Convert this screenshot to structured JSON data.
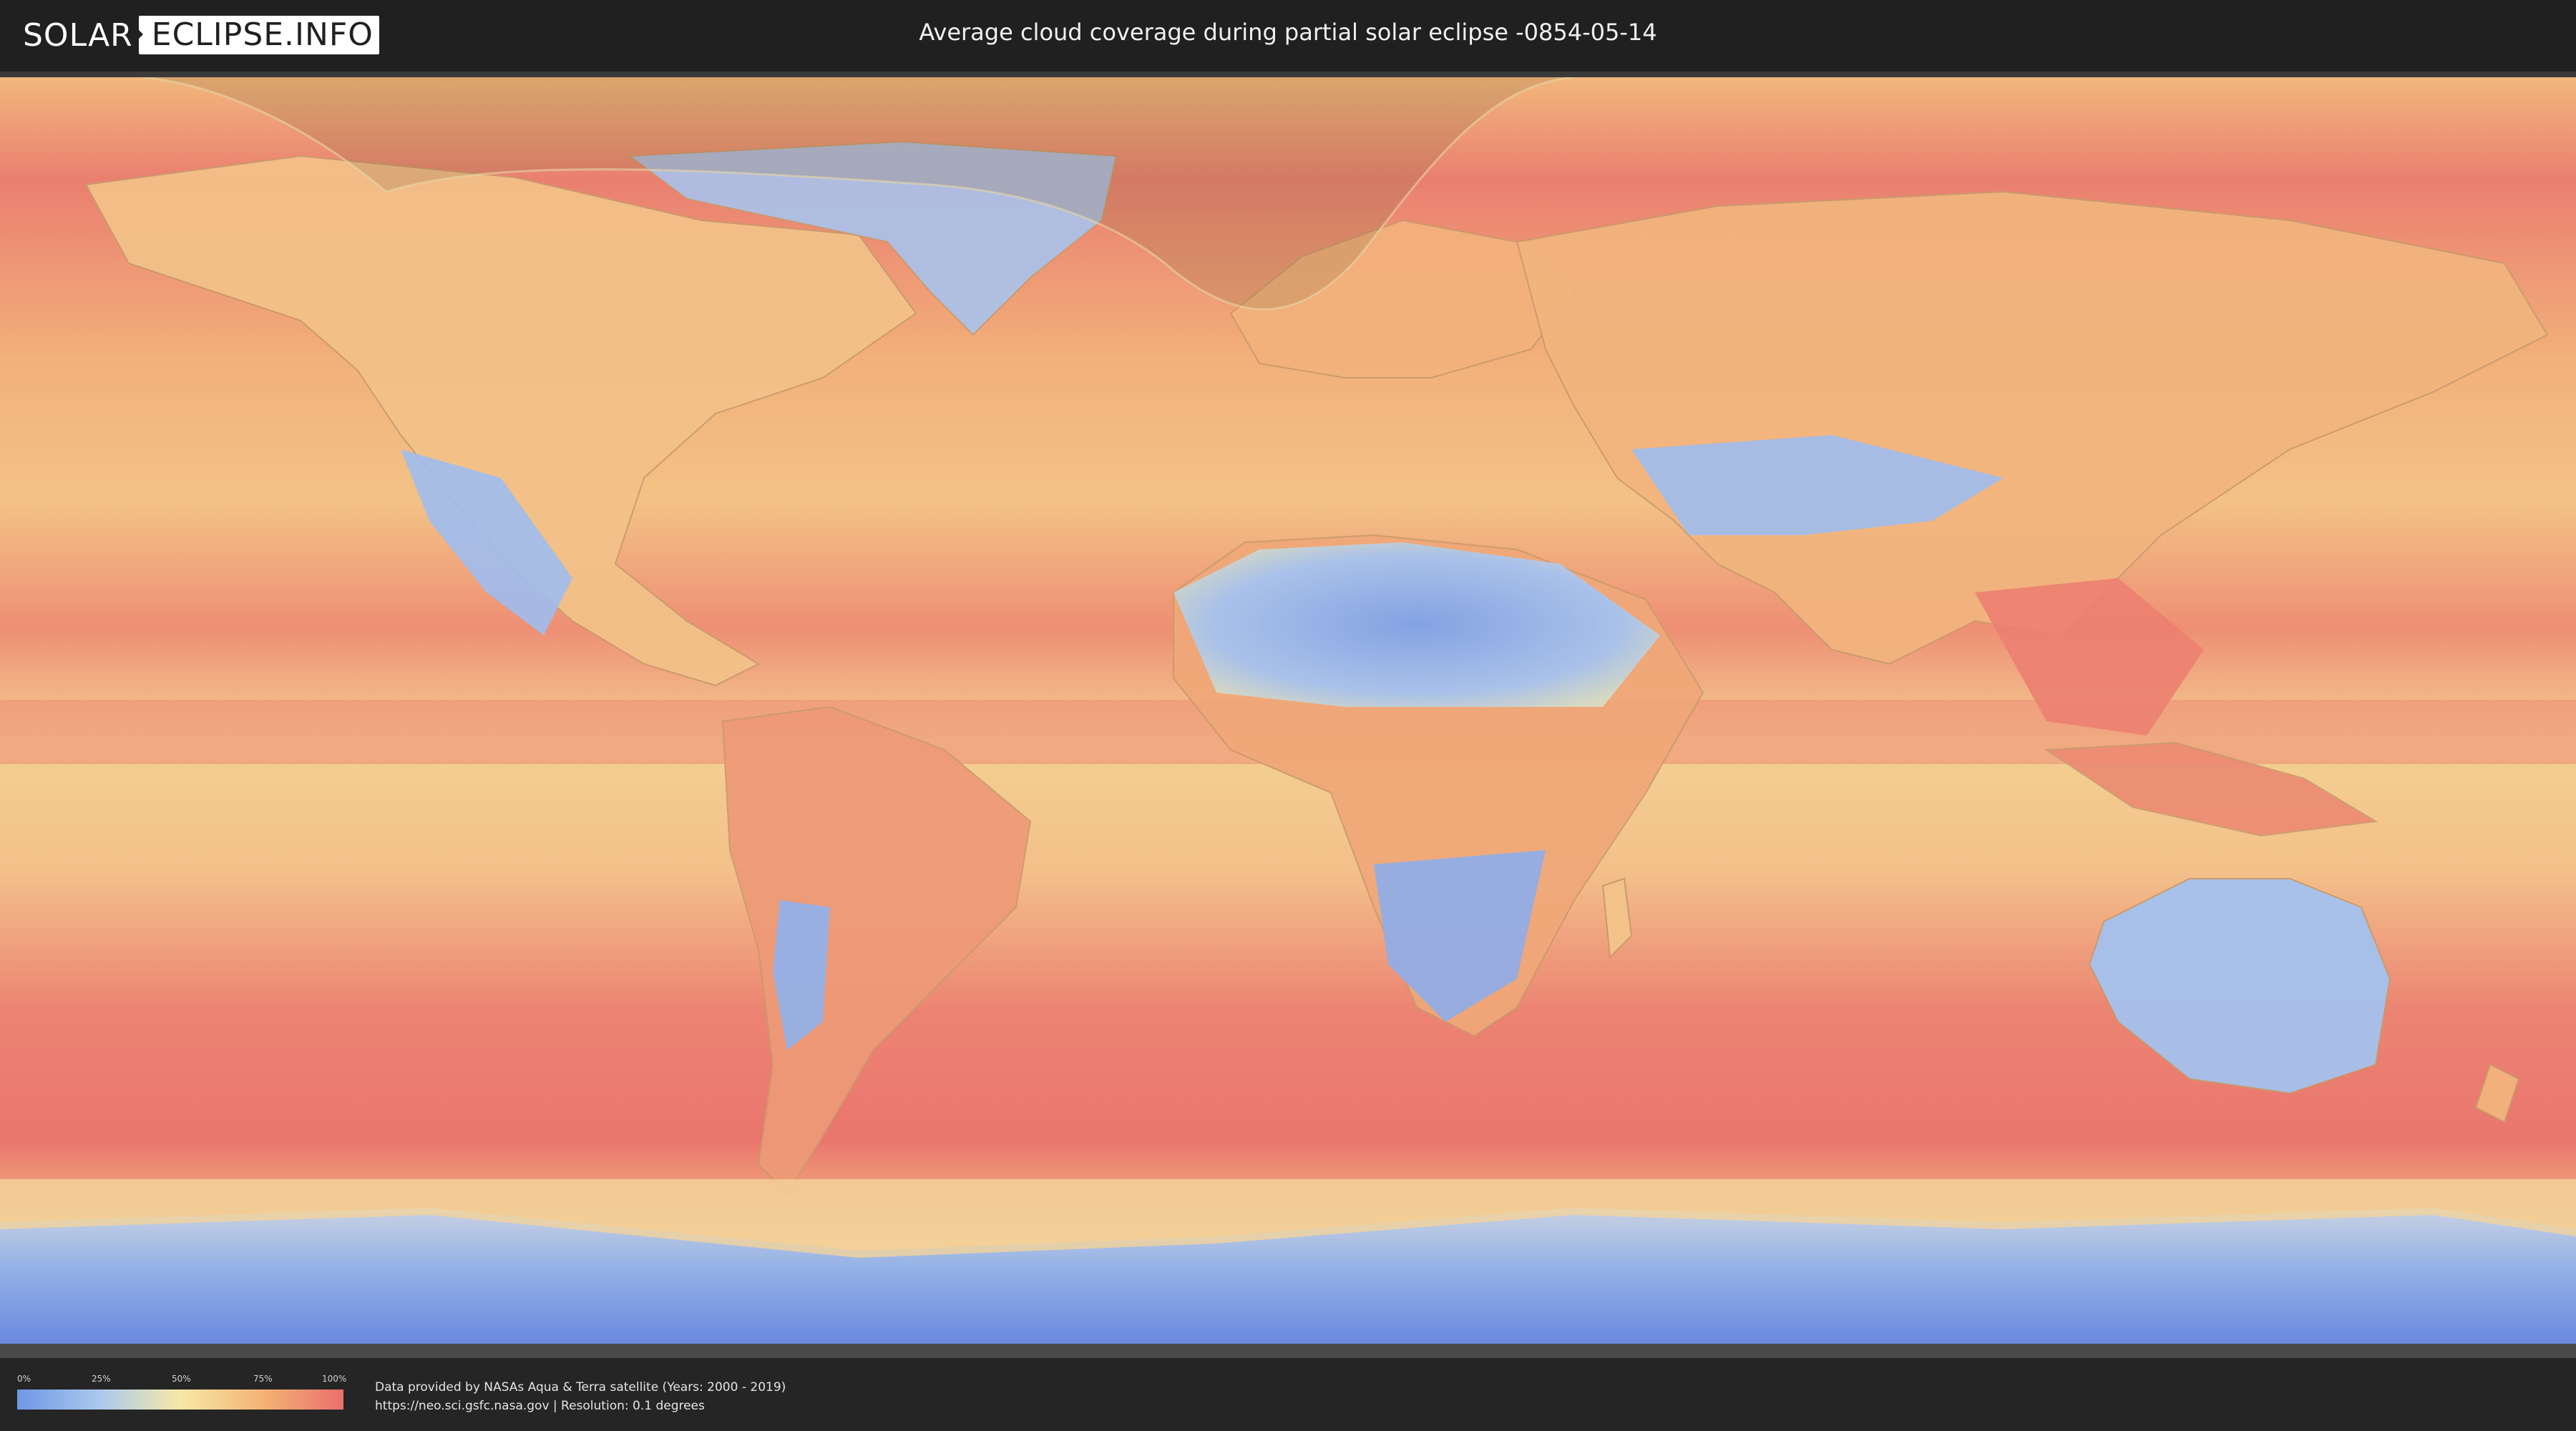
{
  "header": {
    "logo_part1": "SOLAR",
    "logo_part2": "ECLIPSE.INFO",
    "title": "Average cloud coverage during partial solar eclipse -0854-05-14"
  },
  "map": {
    "layer": "average cloud coverage",
    "projection": "equirectangular world map",
    "eclipse_visibility_overlay": "partial eclipse visibility zone (darkened, arctic region)",
    "colors": {
      "low_cloud": "#6f97e6",
      "mid_low": "#a9c8ee",
      "mid": "#f6e8a6",
      "mid_high": "#f4b475",
      "high_cloud": "#ea6f6c"
    }
  },
  "legend": {
    "ticks": [
      "0%",
      "25%",
      "50%",
      "75%",
      "100%"
    ]
  },
  "footer": {
    "attribution_line1": "Data provided by NASAs Aqua & Terra satellite (Years: 2000 - 2019)",
    "attribution_line2": "https://neo.sci.gsfc.nasa.gov | Resolution: 0.1 degrees"
  }
}
